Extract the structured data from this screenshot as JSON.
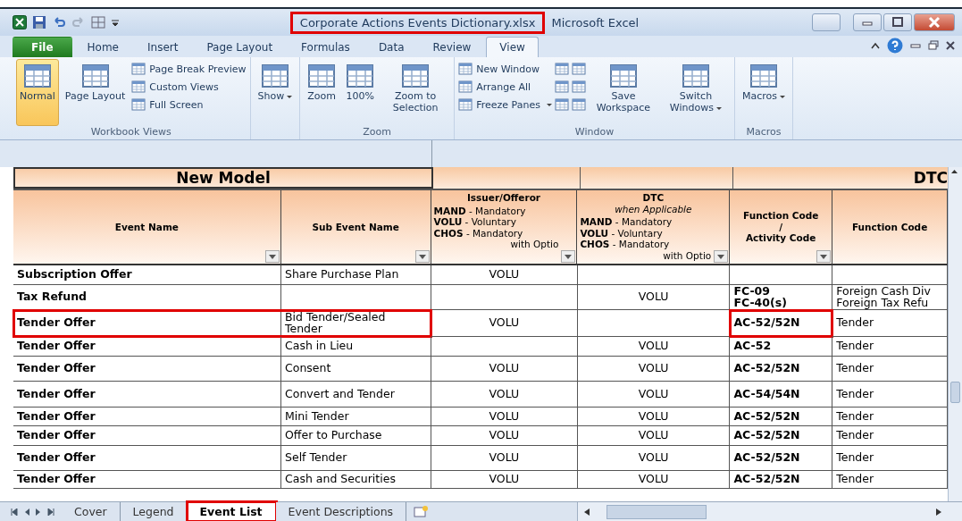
{
  "window": {
    "title": "Corporate Actions Events Dictionary.xlsx",
    "title_marked": true,
    "app_name": "Microsoft Excel"
  },
  "ribbon_tabs": [
    {
      "label": "File",
      "selected": false,
      "kind": "file"
    },
    {
      "label": "Home",
      "selected": false,
      "kind": "tab"
    },
    {
      "label": "Insert",
      "selected": false,
      "kind": "tab"
    },
    {
      "label": "Page Layout",
      "selected": false,
      "kind": "tab"
    },
    {
      "label": "Formulas",
      "selected": false,
      "kind": "tab"
    },
    {
      "label": "Data",
      "selected": false,
      "kind": "tab"
    },
    {
      "label": "Review",
      "selected": false,
      "kind": "tab"
    },
    {
      "label": "View",
      "selected": true,
      "kind": "tab"
    }
  ],
  "ribbon_groups": [
    {
      "label": "Workbook Views",
      "items": [
        {
          "kind": "large",
          "label": "Normal",
          "selected": true,
          "dropdown": false
        },
        {
          "kind": "large",
          "label": "Page Layout",
          "selected": false,
          "dropdown": false
        },
        {
          "kind": "small",
          "label": "Page Break Preview",
          "selected": false,
          "dropdown": false
        },
        {
          "kind": "small",
          "label": "Custom Views",
          "selected": false,
          "dropdown": false
        },
        {
          "kind": "small",
          "label": "Full Screen",
          "selected": false,
          "dropdown": false
        }
      ]
    },
    {
      "items": [
        {
          "kind": "large",
          "label": "Show",
          "selected": false,
          "dropdown": true
        }
      ]
    },
    {
      "label": "Zoom",
      "items": [
        {
          "kind": "large",
          "label": "Zoom",
          "selected": false,
          "dropdown": false
        },
        {
          "kind": "large",
          "label": "100%",
          "selected": false,
          "dropdown": false
        },
        {
          "kind": "large",
          "label": "Zoom to Selection",
          "selected": false,
          "dropdown": false
        }
      ]
    },
    {
      "label": "Window",
      "items": [
        {
          "kind": "small",
          "label": "New Window",
          "selected": false,
          "dropdown": false
        },
        {
          "kind": "small",
          "label": "Arrange All",
          "selected": false,
          "dropdown": false
        },
        {
          "kind": "small",
          "label": "Freeze Panes",
          "selected": false,
          "dropdown": true
        },
        {
          "kind": "icon",
          "selected": false,
          "dropdown": false
        },
        {
          "kind": "icon",
          "selected": false,
          "dropdown": false
        },
        {
          "kind": "icon",
          "selected": false,
          "dropdown": false
        },
        {
          "kind": "icon",
          "selected": false,
          "dropdown": false
        },
        {
          "kind": "icon",
          "selected": false,
          "dropdown": false
        },
        {
          "kind": "icon",
          "selected": false,
          "dropdown": false
        },
        {
          "kind": "large",
          "label": "Save Workspace",
          "selected": false,
          "dropdown": false
        },
        {
          "kind": "large",
          "label": "Switch Windows",
          "selected": false,
          "dropdown": true
        }
      ]
    },
    {
      "label": "Macros",
      "items": [
        {
          "kind": "large",
          "label": "Macros",
          "selected": false,
          "dropdown": true
        }
      ]
    }
  ],
  "sheet": {
    "group_header": "New Model",
    "group_header_2": "DTC",
    "columns": [
      {
        "title": "Event Name",
        "filter": true
      },
      {
        "title": "Sub Event Name",
        "filter": true
      },
      {
        "title": "Issuer/Offeror",
        "legend": [
          "**MAND** - Mandatory",
          "**VOLU** - Voluntary",
          "**CHOS** - Mandatory",
          "with Optio"
        ],
        "filter": true
      },
      {
        "title": "DTC",
        "subtitle": "when Applicable",
        "legend": [
          "**MAND** - Mandatory",
          "**VOLU** - Voluntary",
          "**CHOS** - Mandatory",
          "with Optio"
        ],
        "filter": true
      },
      {
        "title": "Function Code\n/\nActivity Code",
        "filter": true
      },
      {
        "title": "Function Code",
        "filter": false
      }
    ],
    "rows": [
      {
        "event": "Subscription Offer",
        "sub_event": "Share Purchase Plan",
        "issuer": "VOLU",
        "dtc": "",
        "activity_code": "",
        "function_code": "",
        "marked_name": false,
        "marked_code": false
      },
      {
        "event": "Tax Refund",
        "sub_event": "",
        "issuer": "",
        "dtc": "VOLU",
        "activity_code": "FC-09\nFC-40(s)",
        "function_code": "Foreign Cash Div\nForeign Tax Refu",
        "marked_name": false,
        "marked_code": false
      },
      {
        "event": "Tender Offer",
        "sub_event": "Bid Tender/Sealed\nTender",
        "issuer": "VOLU",
        "dtc": "",
        "activity_code": "AC-52/52N",
        "function_code": "Tender",
        "marked_name": true,
        "marked_code": true
      },
      {
        "event": "Tender Offer",
        "sub_event": "Cash in Lieu",
        "issuer": "",
        "dtc": "VOLU",
        "activity_code": "AC-52",
        "function_code": "Tender",
        "marked_name": false,
        "marked_code": false
      },
      {
        "event": "Tender Offer",
        "sub_event": "Consent",
        "issuer": "VOLU",
        "dtc": "VOLU",
        "activity_code": "AC-52/52N",
        "function_code": "Tender",
        "marked_name": false,
        "marked_code": false
      },
      {
        "event": "Tender Offer",
        "sub_event": "Convert and Tender",
        "issuer": "VOLU",
        "dtc": "VOLU",
        "activity_code": "AC-54/54N",
        "function_code": "Tender",
        "marked_name": false,
        "marked_code": false
      },
      {
        "event": "Tender Offer",
        "sub_event": "Mini Tender",
        "issuer": "VOLU",
        "dtc": "VOLU",
        "activity_code": "AC-52/52N",
        "function_code": "Tender",
        "marked_name": false,
        "marked_code": false
      },
      {
        "event": "Tender Offer",
        "sub_event": "Offer to Purchase",
        "issuer": "VOLU",
        "dtc": "VOLU",
        "activity_code": "AC-52/52N",
        "function_code": "Tender",
        "marked_name": false,
        "marked_code": false
      },
      {
        "event": "Tender Offer",
        "sub_event": "Self Tender",
        "issuer": "VOLU",
        "dtc": "VOLU",
        "activity_code": "AC-52/52N",
        "function_code": "Tender",
        "marked_name": false,
        "marked_code": false
      },
      {
        "event": "Tender Offer",
        "sub_event": "Cash and Securities",
        "issuer": "VOLU",
        "dtc": "VOLU",
        "activity_code": "AC-52/52N",
        "function_code": "Tender",
        "marked_name": false,
        "marked_code": false
      }
    ]
  },
  "sheet_tabs": [
    {
      "label": "Cover",
      "selected": false,
      "marked": false
    },
    {
      "label": "Legend",
      "selected": false,
      "marked": false
    },
    {
      "label": "Event List",
      "selected": true,
      "marked": true
    },
    {
      "label": "Event Descriptions",
      "selected": false,
      "marked": false
    }
  ]
}
